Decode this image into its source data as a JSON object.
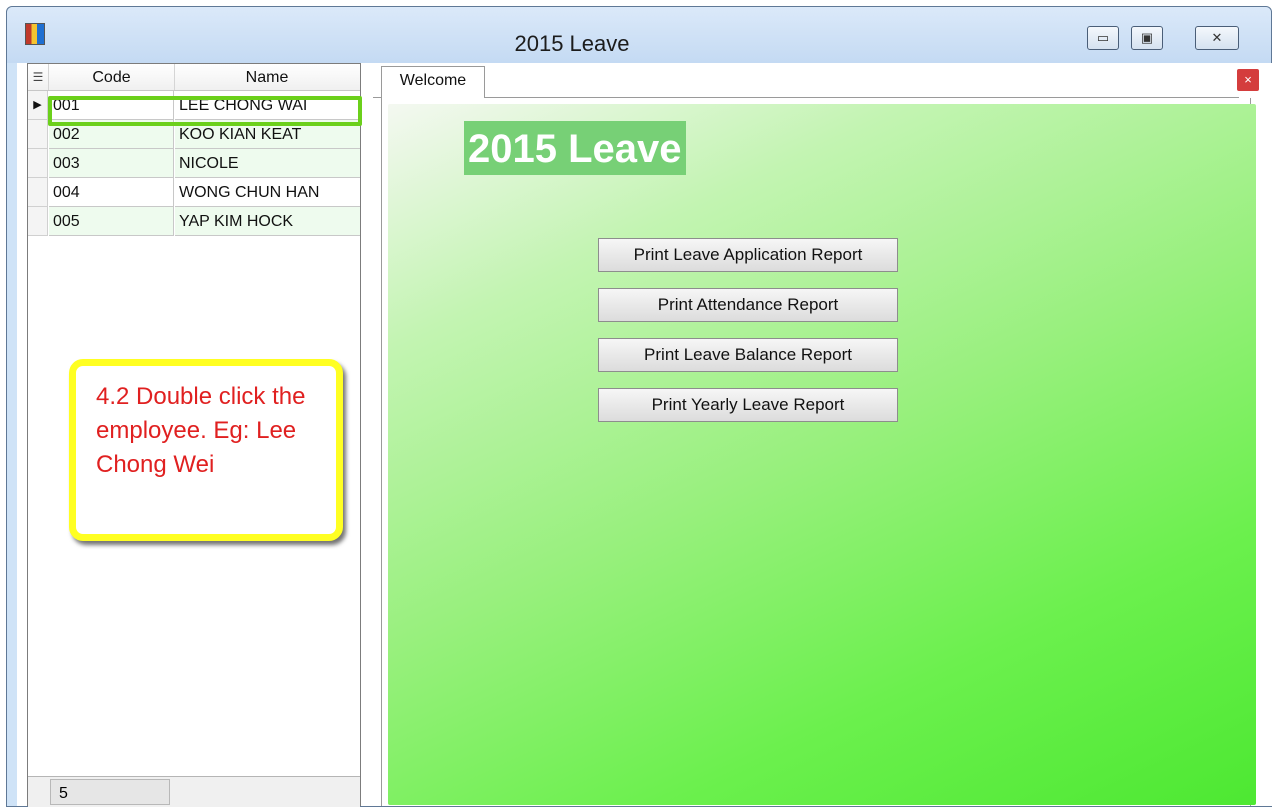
{
  "window": {
    "title": "2015 Leave",
    "icon": "app-icon",
    "controls": {
      "minimize": "▭",
      "maximize": "▣",
      "close": "✕"
    }
  },
  "grid": {
    "columns": [
      "Code",
      "Name"
    ],
    "rows": [
      {
        "code": "001",
        "name": "LEE CHONG WAI",
        "selected": true
      },
      {
        "code": "002",
        "name": "KOO KIAN KEAT"
      },
      {
        "code": "003",
        "name": "NICOLE"
      },
      {
        "code": "004",
        "name": "WONG CHUN HAN"
      },
      {
        "code": "005",
        "name": "YAP KIM HOCK"
      }
    ],
    "record_count": "5",
    "header_icon": "list-icon",
    "row_indicator": "▶"
  },
  "callout": {
    "text": "4.2 Double click the employee. Eg: Lee Chong Wei"
  },
  "tabs": [
    {
      "label": "Welcome",
      "active": true
    }
  ],
  "tab_close": "×",
  "welcome": {
    "banner": "2015 Leave",
    "buttons": [
      "Print Leave Application Report",
      "Print Attendance Report",
      "Print Leave Balance Report",
      "Print Yearly Leave Report"
    ]
  },
  "colors": {
    "highlight": "#6bd01b",
    "callout_border": "#ffff22",
    "callout_text": "#e02020",
    "banner_bg": "#77d076"
  }
}
